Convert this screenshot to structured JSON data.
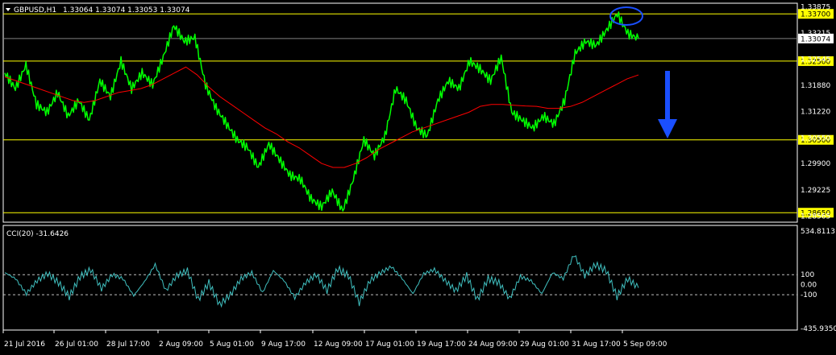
{
  "header": {
    "symbol": "GBPUSD,H1",
    "quote": "1.33064 1.33074 1.33053 1.33074"
  },
  "indicator": {
    "label": "CCI(20) -31.6426"
  },
  "colors": {
    "background": "#000000",
    "price_line": "#00ff00",
    "moving_average": "#ff0000",
    "level_line": "#ffff00",
    "level_badge": "#ffff00",
    "cci_line": "#40c0c0",
    "arrow": "#1a4fff",
    "ellipse": "#1a4fff",
    "axis_text": "#ffffff",
    "frame": "#ffffff"
  },
  "chart_data": [
    {
      "type": "line",
      "title": "GBPUSD,H1",
      "y_axis_ticks": [
        "1.33875",
        "1.33215",
        "1.32545",
        "1.31880",
        "1.31220",
        "1.30550",
        "1.29900",
        "1.29225",
        "1.28565"
      ],
      "ylim": [
        1.2845,
        1.3395
      ],
      "x_tick_labels": [
        "21 Jul 2016",
        "26 Jul 01:00",
        "28 Jul 17:00",
        "2 Aug 09:00",
        "5 Aug 01:00",
        "9 Aug 17:00",
        "12 Aug 09:00",
        "17 Aug 01:00",
        "19 Aug 17:00",
        "24 Aug 09:00",
        "29 Aug 01:00",
        "31 Aug 17:00",
        "5 Sep 09:00"
      ],
      "current_price": "1.33074",
      "horizontal_levels": [
        {
          "value": 1.337,
          "label": "1.33700"
        },
        {
          "value": 1.325,
          "label": "1.32500"
        },
        {
          "value": 1.305,
          "label": "1.30500"
        },
        {
          "value": 1.2865,
          "label": "1.28650"
        }
      ],
      "series": [
        {
          "values": [
            1.322,
            1.318,
            1.324,
            1.314,
            1.312,
            1.317,
            1.311,
            1.315,
            1.31,
            1.32,
            1.316,
            1.325,
            1.318,
            1.322,
            1.319,
            1.326,
            1.334,
            1.33,
            1.331,
            1.319,
            1.313,
            1.309,
            1.305,
            1.303,
            1.298,
            1.304,
            1.3,
            1.296,
            1.295,
            1.29,
            1.288,
            1.292,
            1.287,
            1.295,
            1.305,
            1.301,
            1.306,
            1.318,
            1.315,
            1.308,
            1.306,
            1.315,
            1.32,
            1.318,
            1.325,
            1.323,
            1.32,
            1.326,
            1.312,
            1.31,
            1.308,
            1.311,
            1.309,
            1.315,
            1.327,
            1.33,
            1.329,
            1.333,
            1.337,
            1.332,
            1.3307
          ]
        },
        {
          "values": [
            1.321,
            1.32,
            1.319,
            1.318,
            1.317,
            1.316,
            1.315,
            1.3145,
            1.315,
            1.316,
            1.317,
            1.3175,
            1.318,
            1.319,
            1.3205,
            1.322,
            1.3235,
            1.3215,
            1.3185,
            1.316,
            1.314,
            1.312,
            1.31,
            1.308,
            1.3065,
            1.3045,
            1.303,
            1.301,
            1.299,
            1.298,
            1.298,
            1.299,
            1.3005,
            1.3025,
            1.304,
            1.3055,
            1.307,
            1.308,
            1.309,
            1.31,
            1.311,
            1.312,
            1.3135,
            1.314,
            1.314,
            1.3138,
            1.3136,
            1.3135,
            1.313,
            1.313,
            1.3135,
            1.3145,
            1.316,
            1.3175,
            1.319,
            1.3205,
            1.3215
          ]
        }
      ],
      "annotations": [
        "blue ellipse around peak near 1.33700",
        "blue downward arrow"
      ]
    },
    {
      "type": "line",
      "title": "CCI(20) -31.6426",
      "y_axis_ticks": [
        "534.8113",
        "100",
        "0.00",
        "-100",
        "-435.9350"
      ],
      "ylim": [
        -435.935,
        534.8113
      ],
      "reference_levels": [
        100,
        -100
      ],
      "series": [
        {
          "values": [
            120,
            60,
            -90,
            40,
            110,
            20,
            -120,
            80,
            150,
            -40,
            100,
            60,
            -110,
            30,
            200,
            -60,
            90,
            140,
            -150,
            20,
            -200,
            -100,
            60,
            120,
            -80,
            140,
            40,
            -130,
            20,
            100,
            -60,
            160,
            90,
            -180,
            40,
            120,
            180,
            60,
            -90,
            110,
            150,
            40,
            -60,
            90,
            -150,
            60,
            20,
            -140,
            80,
            40,
            -90,
            120,
            60,
            300,
            90,
            200,
            140,
            -120,
            60,
            -31.6
          ]
        }
      ]
    }
  ]
}
